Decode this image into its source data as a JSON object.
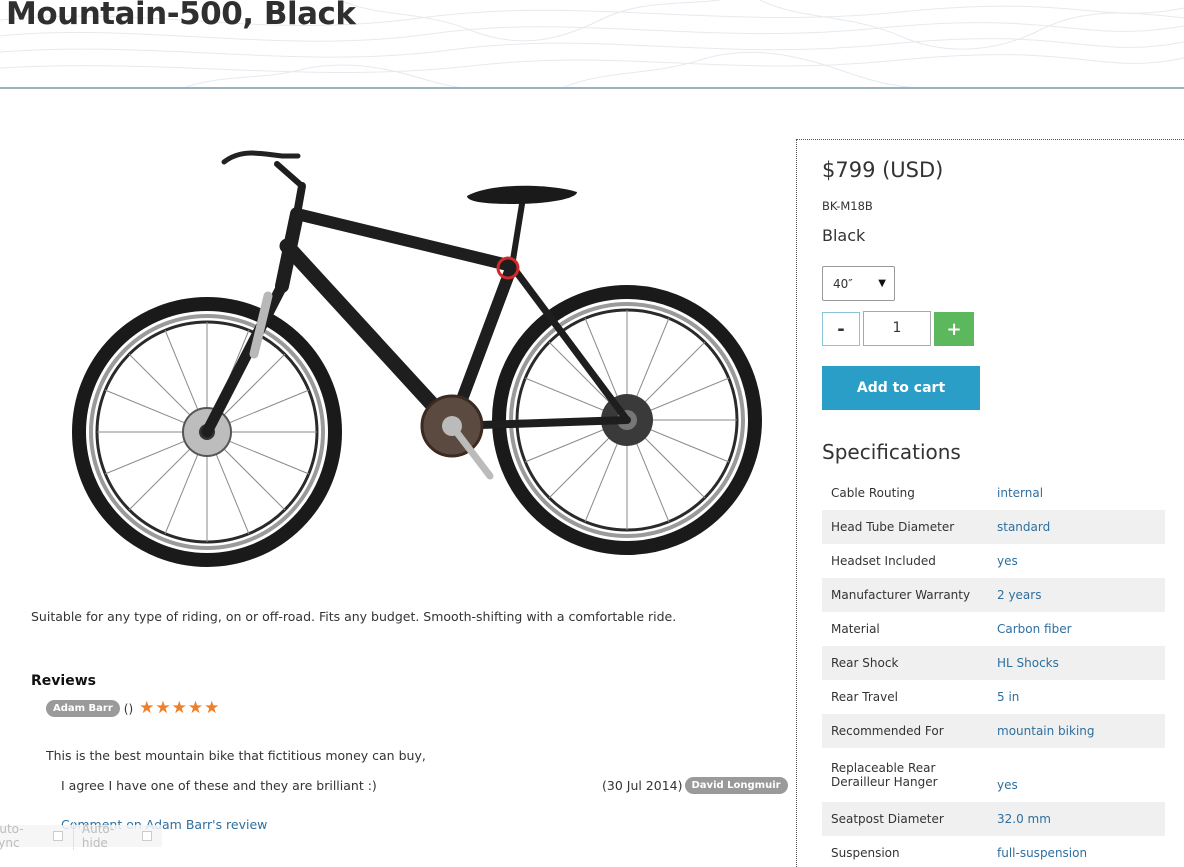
{
  "page": {
    "title": "Mountain-500, Black"
  },
  "product": {
    "description": "Suitable for any type of riding, on or off-road. Fits any budget. Smooth-shifting with a comfortable ride.",
    "price": "$799 (USD)",
    "sku": "BK-M18B",
    "color": "Black",
    "size_selected": "40″",
    "quantity": "1",
    "minus_label": "-",
    "plus_label": "+",
    "add_to_cart_label": "Add to cart"
  },
  "reviews": {
    "heading": "Reviews",
    "items": [
      {
        "author": "Adam Barr",
        "parens": "()",
        "rating": 5,
        "text": "This is the best mountain bike that fictitious money can buy,",
        "replies": [
          {
            "text": "I agree I have one of these and they are brilliant :)",
            "date": "(30 Jul 2014)",
            "author": "David Longmuir"
          }
        ],
        "comment_link": "Comment on Adam Barr's review"
      }
    ]
  },
  "specifications": {
    "heading": "Specifications",
    "rows": [
      {
        "name": "Cable Routing",
        "value": "internal"
      },
      {
        "name": "Head Tube Diameter",
        "value": "standard"
      },
      {
        "name": "Headset Included",
        "value": "yes"
      },
      {
        "name": "Manufacturer Warranty",
        "value": "2 years"
      },
      {
        "name": "Material",
        "value": "Carbon fiber"
      },
      {
        "name": "Rear Shock",
        "value": "HL Shocks"
      },
      {
        "name": "Rear Travel",
        "value": "5 in"
      },
      {
        "name": "Recommended For",
        "value": "mountain biking"
      },
      {
        "name": "Replaceable Rear Derailleur Hanger",
        "value": "yes"
      },
      {
        "name": "Seatpost Diameter",
        "value": "32.0 mm"
      },
      {
        "name": "Suspension",
        "value": "full-suspension"
      }
    ]
  },
  "debug": {
    "auto_sync": "auto-sync",
    "auto_hide": "Auto-hide"
  },
  "colors": {
    "accent_blue": "#2b9ec8",
    "plus_green": "#5cb85c",
    "link": "#2e6f9e",
    "star": "#f07f29",
    "header_rule": "#9bb1bf"
  },
  "icons": {
    "star": "star-icon",
    "select_caret": "caret-down-icon"
  }
}
